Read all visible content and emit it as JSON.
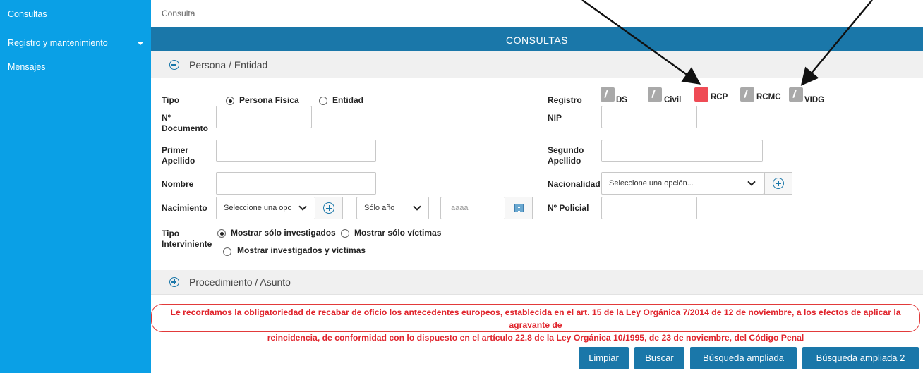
{
  "sidebar": {
    "items": [
      {
        "label": "Consultas"
      },
      {
        "label": "Registro y mantenimiento"
      },
      {
        "label": "Mensajes"
      }
    ]
  },
  "breadcrumb": "Consulta",
  "header": {
    "title": "CONSULTAS"
  },
  "sections": {
    "persona": "Persona / Entidad",
    "procedimiento": "Procedimiento / Asunto"
  },
  "form": {
    "tipo": {
      "label": "Tipo",
      "options": [
        "Persona Física",
        "Entidad"
      ],
      "selected": "Persona Física"
    },
    "n_documento": {
      "label_1": "Nº",
      "label_2": "Documento",
      "value": ""
    },
    "primer_apellido": {
      "label_1": "Primer",
      "label_2": "Apellido",
      "value": ""
    },
    "nombre": {
      "label": "Nombre",
      "value": ""
    },
    "nacimiento": {
      "label": "Nacimiento",
      "select_value": "Seleccione una opc",
      "period_value": "Sólo año",
      "year_placeholder": "aaaa"
    },
    "tipo_interviniente": {
      "label_1": "Tipo",
      "label_2": "Interviniente",
      "options": [
        "Mostrar sólo investigados",
        "Mostrar sólo víctimas",
        "Mostrar investigados y víctimas"
      ],
      "selected": "Mostrar sólo investigados"
    },
    "registro": {
      "label": "Registro",
      "items": [
        {
          "label": "DS",
          "checked": false
        },
        {
          "label": "Civil",
          "checked": false
        },
        {
          "label": "RCP",
          "checked": true
        },
        {
          "label": "RCMC",
          "checked": false
        },
        {
          "label": "VIDG",
          "checked": false
        }
      ]
    },
    "nip": {
      "label": "NIP",
      "value": ""
    },
    "segundo_apellido": {
      "label_1": "Segundo",
      "label_2": "Apellido",
      "value": ""
    },
    "nacionalidad": {
      "label": "Nacionalidad",
      "select_value": "Seleccione una opción..."
    },
    "n_policial": {
      "label": "Nº Policial",
      "value": ""
    }
  },
  "warning": {
    "line1": "Le recordamos la obligatoriedad de recabar de oficio los antecedentes europeos, establecida en el art. 15 de la Ley Orgánica 7/2014 de 12 de noviembre, a los efectos de aplicar la agravante de",
    "line2": "reincidencia, de conformidad con lo dispuesto en el artículo 22.8 de la Ley Orgánica 10/1995, de 23 de noviembre, del Código Penal"
  },
  "buttons": {
    "limpiar": "Limpiar",
    "buscar": "Buscar",
    "busqueda_ampliada": "Búsqueda ampliada",
    "busqueda_ampliada_2": "Búsqueda ampliada 2"
  },
  "colors": {
    "sidebar": "#0aa0e6",
    "header": "#1a77a9",
    "accent": "#1a77a9",
    "checked_registry": "#ef4b55",
    "warning": "#e0242c"
  }
}
